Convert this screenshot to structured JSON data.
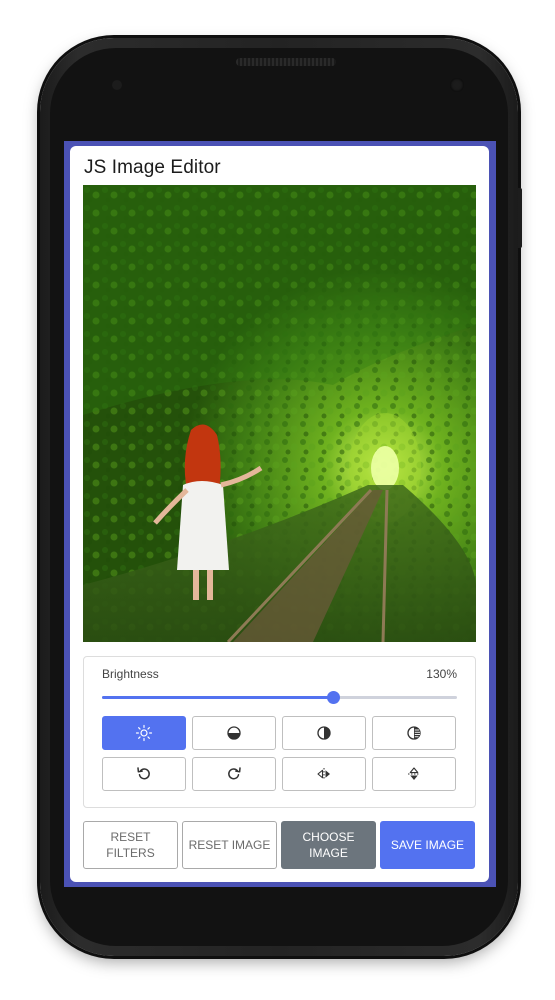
{
  "app": {
    "title": "JS Image Editor"
  },
  "filter": {
    "name": "Brightness",
    "value_text": "130%",
    "value": 130,
    "min": 0,
    "max": 200
  },
  "filter_buttons": [
    {
      "id": "brightness",
      "icon": "brightness-icon",
      "active": true
    },
    {
      "id": "saturation",
      "icon": "saturation-icon",
      "active": false
    },
    {
      "id": "inversion",
      "icon": "inversion-icon",
      "active": false
    },
    {
      "id": "grayscale",
      "icon": "grayscale-icon",
      "active": false
    }
  ],
  "transform_buttons": [
    {
      "id": "rotate-left",
      "icon": "rotate-left-icon"
    },
    {
      "id": "rotate-right",
      "icon": "rotate-right-icon"
    },
    {
      "id": "flip-horizontal",
      "icon": "flip-horizontal-icon"
    },
    {
      "id": "flip-vertical",
      "icon": "flip-vertical-icon"
    }
  ],
  "actions": {
    "reset_filters": "RESET FILTERS",
    "reset_image": "RESET IMAGE",
    "choose_image": "CHOOSE IMAGE",
    "save_image": "SAVE IMAGE"
  },
  "colors": {
    "accent": "#5372f0",
    "screen_bg": "#4b52b5",
    "choose_button": "#6c757d"
  }
}
